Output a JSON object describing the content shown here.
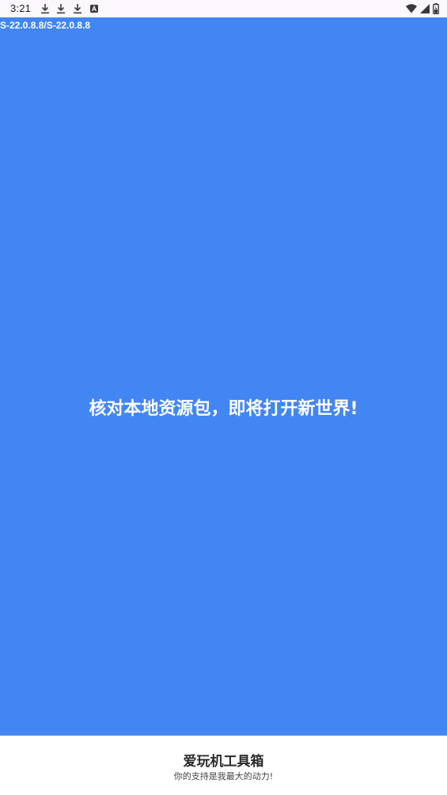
{
  "status_bar": {
    "time": "3:21",
    "notification_icons": [
      "download-icon",
      "download-icon",
      "download-icon",
      "font-icon"
    ],
    "system_icons": [
      "wifi-icon",
      "signal-icon",
      "battery-icon"
    ],
    "background": "#fbf7fc"
  },
  "splash": {
    "version": "S-22.0.8.8/S-22.0.8.8",
    "message": "核对本地资源包，即将打开新世界!",
    "background": "#4286f4"
  },
  "footer": {
    "app_name": "爱玩机工具箱",
    "slogan": "你的支持是我最大的动力!"
  }
}
